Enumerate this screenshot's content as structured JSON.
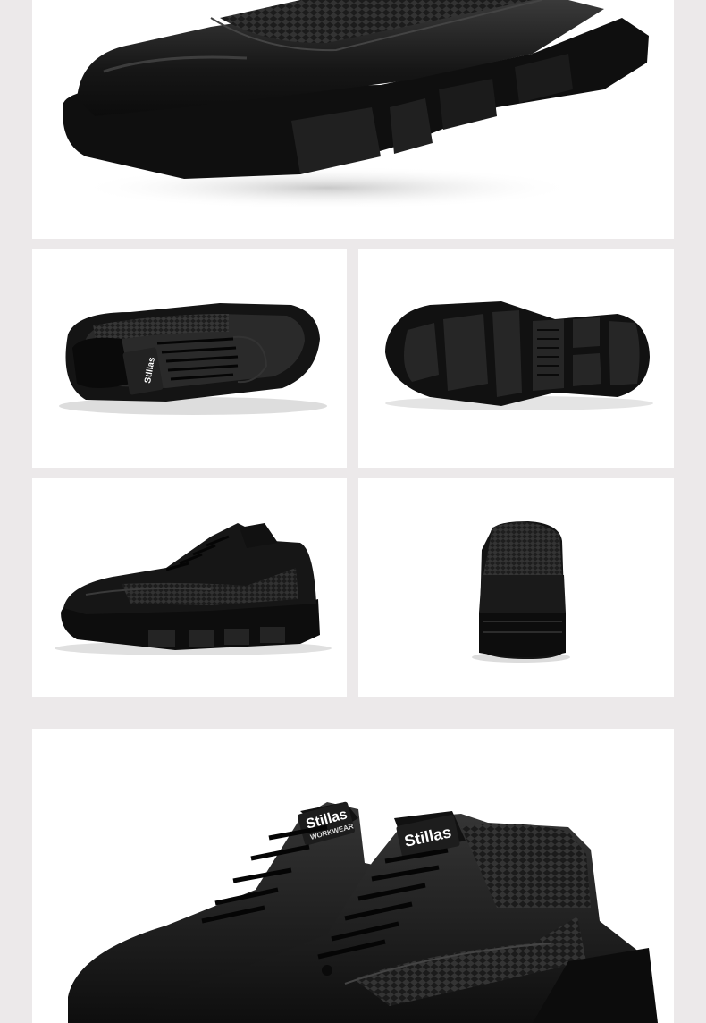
{
  "product": {
    "brand_tag": "Stillas",
    "tag_subtext": "WORKWEAR"
  },
  "panels": [
    {
      "id": "toe-closeup",
      "view": "toe close-up"
    },
    {
      "id": "top-view",
      "view": "top view"
    },
    {
      "id": "sole-view",
      "view": "outsole"
    },
    {
      "id": "side-view",
      "view": "side profile"
    },
    {
      "id": "back-view",
      "view": "heel view"
    },
    {
      "id": "pair-view",
      "view": "pair"
    }
  ],
  "colors": {
    "background": "#ece9ea",
    "panel": "#ffffff",
    "shoe": "#1a1a1a",
    "sole": "#0f0f0f",
    "mesh": "#2a2a2a"
  }
}
